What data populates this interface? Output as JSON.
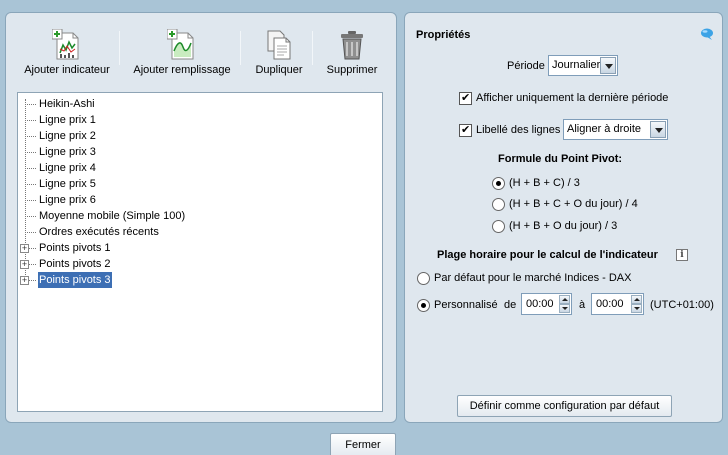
{
  "toolbar": {
    "add_indicator": "Ajouter indicateur",
    "add_fill": "Ajouter remplissage",
    "duplicate": "Dupliquer",
    "delete": "Supprimer"
  },
  "tree": {
    "items": [
      {
        "label": "Heikin-Ashi",
        "expandable": false
      },
      {
        "label": "Ligne prix 1",
        "expandable": false
      },
      {
        "label": "Ligne prix 2",
        "expandable": false
      },
      {
        "label": "Ligne prix 3",
        "expandable": false
      },
      {
        "label": "Ligne prix 4",
        "expandable": false
      },
      {
        "label": "Ligne prix 5",
        "expandable": false
      },
      {
        "label": "Ligne prix 6",
        "expandable": false
      },
      {
        "label": "Moyenne mobile (Simple 100)",
        "expandable": false
      },
      {
        "label": "Ordres exécutés récents",
        "expandable": false
      },
      {
        "label": "Points pivots 1",
        "expandable": true
      },
      {
        "label": "Points pivots 2",
        "expandable": true
      },
      {
        "label": "Points pivots 3",
        "expandable": true,
        "selected": true
      }
    ],
    "expander_symbol": "+"
  },
  "properties": {
    "title": "Propriétés",
    "period_label": "Période",
    "period_value": "Journalier",
    "last_period_only_label": "Afficher uniquement la dernière période",
    "last_period_only_checked": true,
    "line_labels_label": "Libellé des lignes",
    "line_labels_checked": true,
    "line_labels_value": "Aligner à droite",
    "formula_title": "Formule du Point Pivot:",
    "formula_options": [
      {
        "label": "(H + B + C) / 3",
        "selected": true
      },
      {
        "label": "(H + B + C + O du jour) / 4",
        "selected": false
      },
      {
        "label": "(H + B + O du jour) / 3",
        "selected": false
      }
    ],
    "time_range_title": "Plage horaire pour le calcul de l'indicateur",
    "info_symbol": "i",
    "default_market_label": "Par défaut pour le marché Indices - DAX",
    "default_market_selected": false,
    "custom_label": "Personnalisé",
    "custom_selected": true,
    "from_label": "de",
    "from_time": "00:00",
    "to_label": "à",
    "to_time": "00:00",
    "timezone": "(UTC+01:00)",
    "set_default_button": "Définir comme configuration par défaut"
  },
  "footer": {
    "close_button": "Fermer"
  },
  "colors": {
    "background": "#a9c4d6",
    "panel": "#dfe7ee",
    "selection": "#3d6fb4"
  }
}
